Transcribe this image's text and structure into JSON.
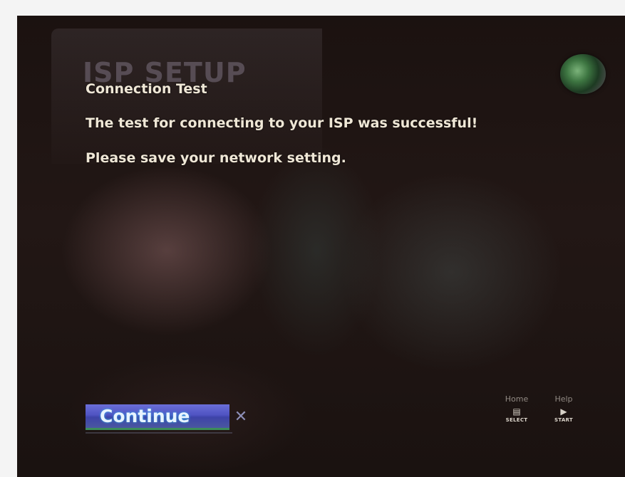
{
  "screen": {
    "watermark": "ISP SETUP",
    "title": "Connection Test",
    "status_message": "The test for connecting to your ISP was successful!",
    "instruction": "Please save your network setting."
  },
  "actions": {
    "continue_label": "Continue",
    "cancel_glyph": "✕"
  },
  "remote_hints": {
    "home_label": "Home",
    "home_key": "SELECT",
    "home_glyph": "▤",
    "help_label": "Help",
    "help_key": "START",
    "help_glyph": "▶"
  },
  "colors": {
    "button": "#5357c9",
    "text": "#efe7d6",
    "status_orb": "#3d7541"
  },
  "icons": [
    "status-orb-icon",
    "close-icon",
    "select-button-icon",
    "start-button-icon"
  ]
}
